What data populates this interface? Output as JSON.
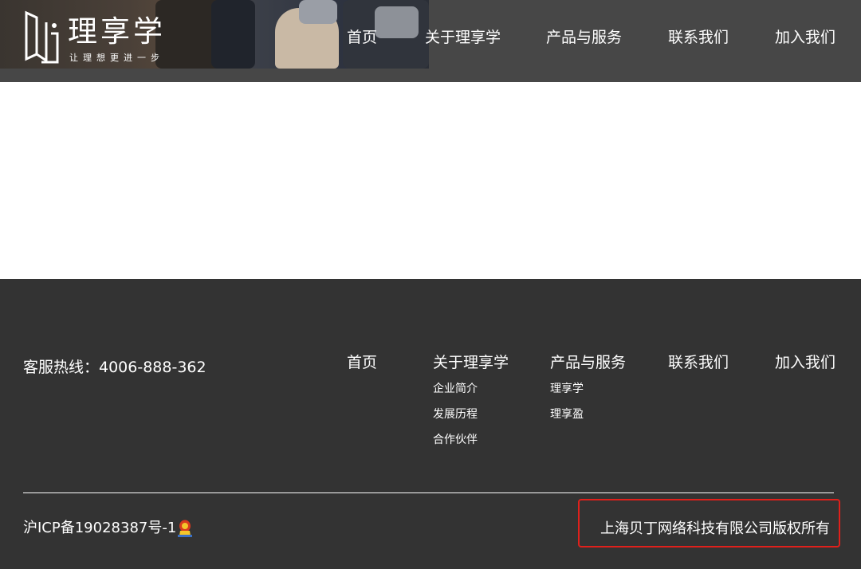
{
  "header": {
    "logo": {
      "name": "理享学",
      "slogan": "让理想更进一步"
    },
    "nav": [
      {
        "label": "首页"
      },
      {
        "label": "关于理享学"
      },
      {
        "label": "产品与服务"
      },
      {
        "label": "联系我们"
      },
      {
        "label": "加入我们"
      }
    ]
  },
  "footer": {
    "hotline": "客服热线：4006-888-362",
    "columns": [
      {
        "title": "首页",
        "items": []
      },
      {
        "title": "关于理享学",
        "items": [
          "企业简介",
          "发展历程",
          "合作伙伴"
        ]
      },
      {
        "title": "产品与服务",
        "items": [
          "理享学",
          "理享盈"
        ]
      },
      {
        "title": "联系我们",
        "items": []
      },
      {
        "title": "加入我们",
        "items": []
      }
    ],
    "icp": "沪ICP备19028387号-1",
    "copyright": "上海贝丁网络科技有限公司版权所有"
  },
  "colors": {
    "header_bg": "#474747",
    "footer_bg": "#333333",
    "annotation_box": "#e0201b"
  }
}
